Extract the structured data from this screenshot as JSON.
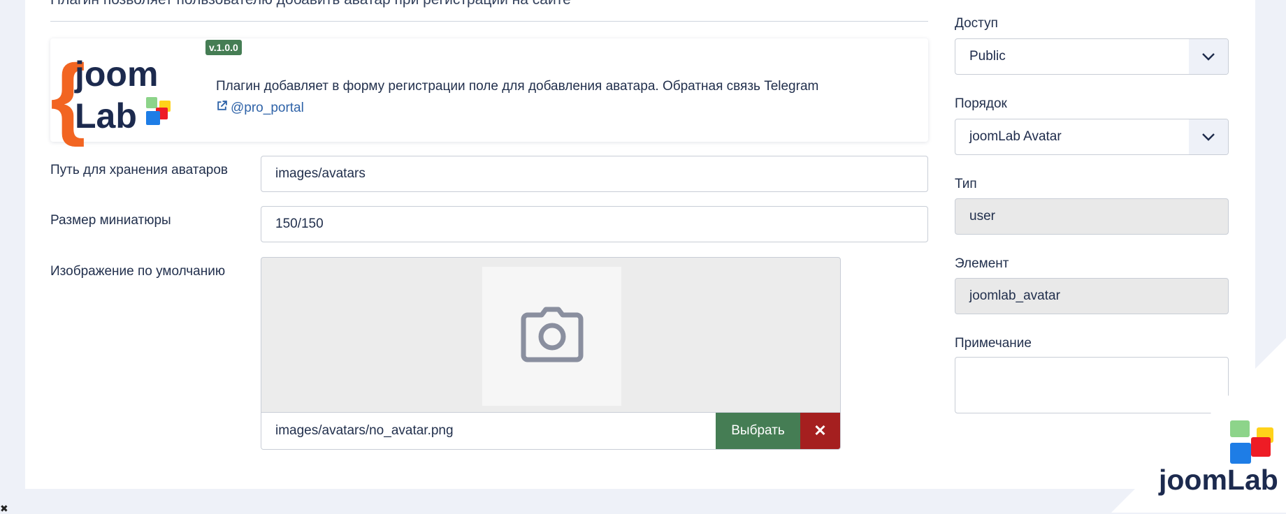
{
  "plugin": {
    "description_top": "Плагин позволяет пользователю добавить аватар при регистрации на сайте",
    "logo_word_1": "joom",
    "logo_word_2": "Lab",
    "version": "v.1.0.0",
    "info_text": "Плагин добавляет в форму регистрации поле для добавления аватара. Обратная связь Telegram",
    "telegram_link": "@pro_portal"
  },
  "form": {
    "avatar_path": {
      "label": "Путь для хранения аватаров",
      "value": "images/avatars"
    },
    "thumb_size": {
      "label": "Размер миниатюры",
      "value": "150/150"
    },
    "default_image": {
      "label": "Изображение по умолчанию",
      "value": "images/avatars/no_avatar.png",
      "select_label": "Выбрать",
      "clear_label": "✕"
    }
  },
  "sidebar": {
    "access": {
      "label": "Доступ",
      "value": "Public"
    },
    "ordering": {
      "label": "Порядок",
      "value": "joomLab Avatar"
    },
    "type": {
      "label": "Тип",
      "value": "user"
    },
    "element": {
      "label": "Элемент",
      "value": "joomlab_avatar"
    },
    "note": {
      "label": "Примечание",
      "value": ""
    }
  },
  "watermark": {
    "text": "joomLab"
  },
  "colors": {
    "success": "#457d54",
    "danger": "#a51f1f",
    "link": "#2f63a8",
    "brand_orange": "#f26522",
    "brand_navy": "#1c2a4e",
    "tile_green": "#8dd48a",
    "tile_yellow": "#ffd21a",
    "tile_red": "#ee1c25",
    "tile_blue": "#1e7de6"
  },
  "icons": {
    "external_link": "external-link-icon",
    "chevron": "chevron-down-icon",
    "camera": "camera-icon",
    "close": "close-icon"
  }
}
